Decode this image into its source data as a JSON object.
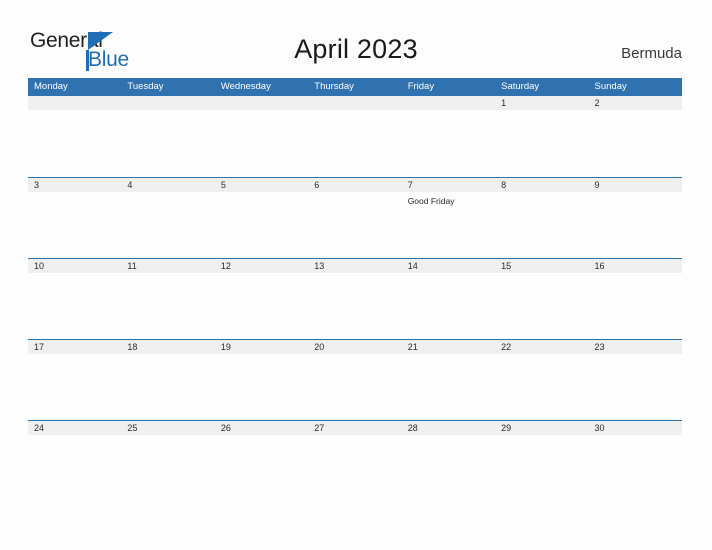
{
  "brand": {
    "name_top": "General",
    "name_bottom": "Blue",
    "triangle_icon": "triangle-icon",
    "accent_color": "#1f6eb5"
  },
  "header": {
    "title": "April 2023",
    "locale": "Bermuda"
  },
  "calendar": {
    "header_bg": "#3071b0",
    "band_bg": "#efefef",
    "weekdays": [
      "Monday",
      "Tuesday",
      "Wednesday",
      "Thursday",
      "Friday",
      "Saturday",
      "Sunday"
    ],
    "weeks": [
      {
        "days": [
          {
            "number": "",
            "event": ""
          },
          {
            "number": "",
            "event": ""
          },
          {
            "number": "",
            "event": ""
          },
          {
            "number": "",
            "event": ""
          },
          {
            "number": "",
            "event": ""
          },
          {
            "number": "1",
            "event": ""
          },
          {
            "number": "2",
            "event": ""
          }
        ]
      },
      {
        "days": [
          {
            "number": "3",
            "event": ""
          },
          {
            "number": "4",
            "event": ""
          },
          {
            "number": "5",
            "event": ""
          },
          {
            "number": "6",
            "event": ""
          },
          {
            "number": "7",
            "event": "Good Friday"
          },
          {
            "number": "8",
            "event": ""
          },
          {
            "number": "9",
            "event": ""
          }
        ]
      },
      {
        "days": [
          {
            "number": "10",
            "event": ""
          },
          {
            "number": "11",
            "event": ""
          },
          {
            "number": "12",
            "event": ""
          },
          {
            "number": "13",
            "event": ""
          },
          {
            "number": "14",
            "event": ""
          },
          {
            "number": "15",
            "event": ""
          },
          {
            "number": "16",
            "event": ""
          }
        ]
      },
      {
        "days": [
          {
            "number": "17",
            "event": ""
          },
          {
            "number": "18",
            "event": ""
          },
          {
            "number": "19",
            "event": ""
          },
          {
            "number": "20",
            "event": ""
          },
          {
            "number": "21",
            "event": ""
          },
          {
            "number": "22",
            "event": ""
          },
          {
            "number": "23",
            "event": ""
          }
        ]
      },
      {
        "days": [
          {
            "number": "24",
            "event": ""
          },
          {
            "number": "25",
            "event": ""
          },
          {
            "number": "26",
            "event": ""
          },
          {
            "number": "27",
            "event": ""
          },
          {
            "number": "28",
            "event": ""
          },
          {
            "number": "29",
            "event": ""
          },
          {
            "number": "30",
            "event": ""
          }
        ]
      }
    ]
  }
}
